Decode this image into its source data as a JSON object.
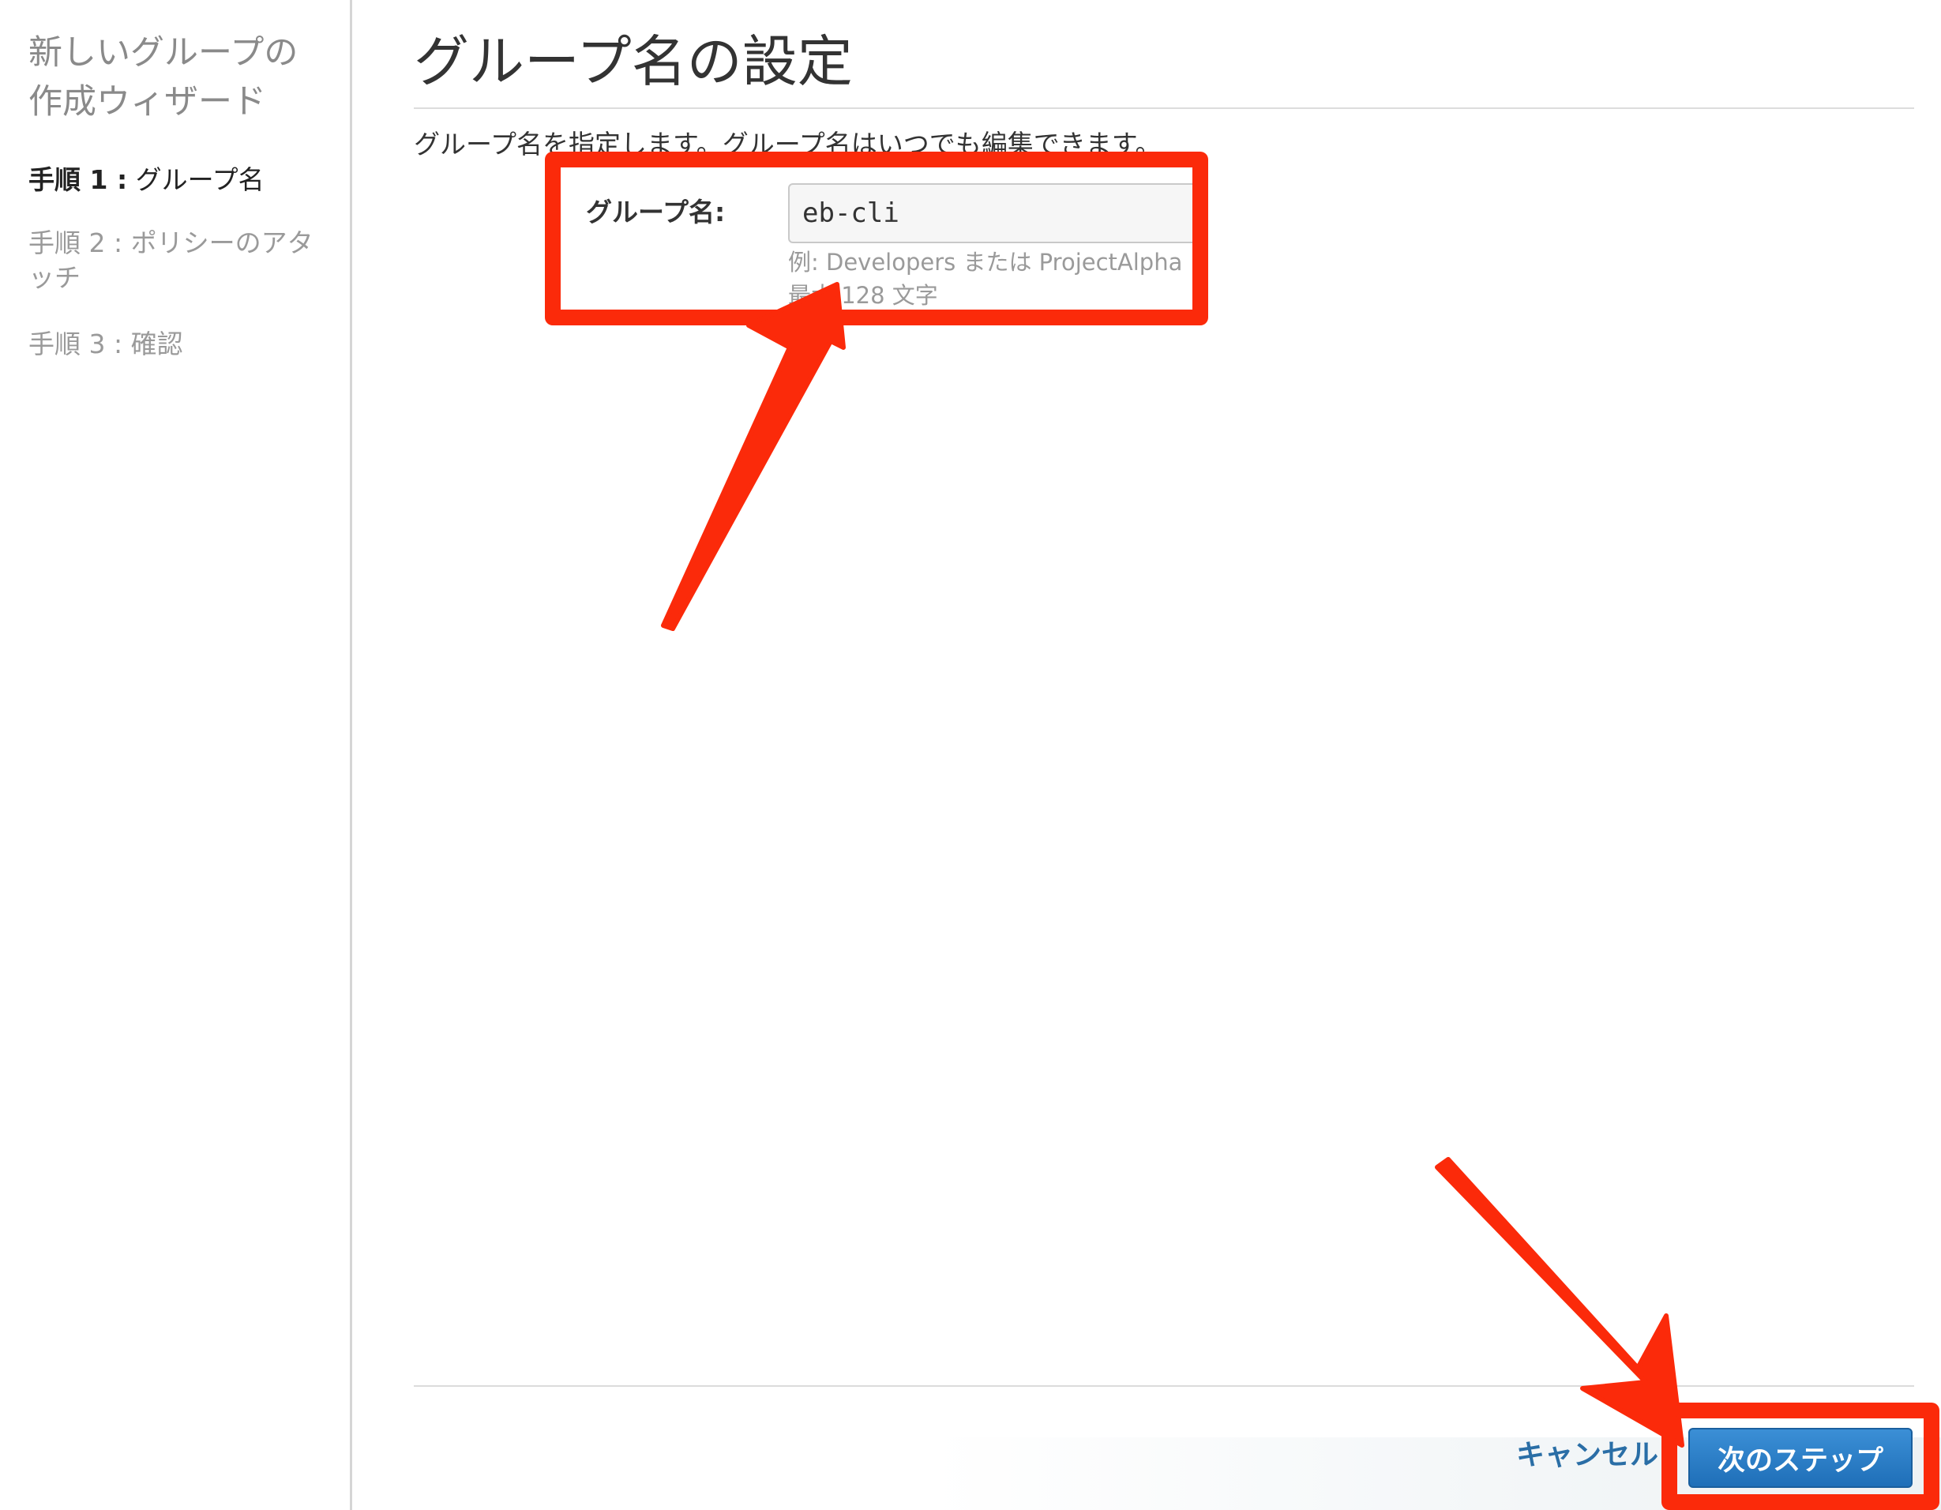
{
  "sidebar": {
    "title": "新しいグループの作成ウィザード",
    "steps": [
      {
        "num": "手順 1 :",
        "label": "グループ名",
        "active": true
      },
      {
        "num": "手順 2 :",
        "label": "ポリシーのアタッチ",
        "active": false
      },
      {
        "num": "手順 3 :",
        "label": "確認",
        "active": false
      }
    ]
  },
  "main": {
    "title": "グループ名の設定",
    "description": "グループ名を指定します。グループ名はいつでも編集できます。",
    "field": {
      "label": "グループ名:",
      "value": "eb-cli",
      "hint_example": "例: Developers または ProjectAlpha",
      "hint_limit": "最大 128 文字"
    }
  },
  "footer": {
    "cancel_label": "キャンセル",
    "next_label": "次のステップ"
  },
  "colors": {
    "annotation_red": "#fb2a0a",
    "button_blue": "#1f6fb8",
    "link_blue": "#2a6ea6"
  }
}
